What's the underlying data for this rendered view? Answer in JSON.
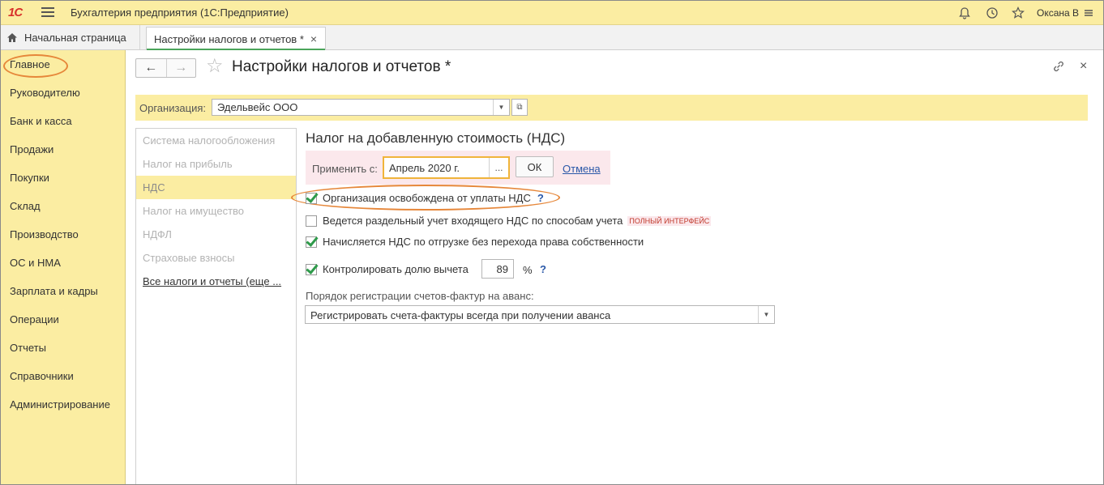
{
  "app": {
    "logo": "1С",
    "title": "Бухгалтерия предприятия",
    "subtitle": "(1С:Предприятие)",
    "user": "Оксана В",
    "accent_color": "#fbeda2",
    "icons": [
      "bell-icon",
      "history-icon",
      "star-icon",
      "chevron-down-icon"
    ]
  },
  "tabs": {
    "home": "Начальная страница",
    "active": "Настройки налогов и отчетов *",
    "close": "×"
  },
  "sidebar": {
    "items": [
      "Главное",
      "Руководителю",
      "Банк и касса",
      "Продажи",
      "Покупки",
      "Склад",
      "Производство",
      "ОС и НМА",
      "Зарплата и кадры",
      "Операции",
      "Отчеты",
      "Справочники",
      "Администрирование"
    ]
  },
  "page": {
    "title": "Настройки налогов и отчетов *"
  },
  "org": {
    "label": "Организация:",
    "value": "Эдельвейс ООО"
  },
  "sections": {
    "items": [
      "Система налогообложения",
      "Налог на прибыль",
      "НДС",
      "Налог на имущество",
      "НДФЛ",
      "Страховые взносы",
      "Все налоги и отчеты (еще ..."
    ],
    "active_index": 2
  },
  "vat": {
    "title": "Налог на добавленную стоимость (НДС)",
    "apply_label": "Применить с:",
    "apply_date": "Апрель 2020 г.",
    "dots": "...",
    "ok": "ОК",
    "cancel": "Отмена",
    "exempt_label": "Организация освобождена от уплаты НДС",
    "exempt_checked": true,
    "separate_label": "Ведется раздельный учет входящего НДС по способам учета",
    "separate_checked": false,
    "full_interface": "полный интерфейс",
    "shipment_label": "Начисляется НДС по отгрузке без перехода права собственности",
    "shipment_checked": true,
    "control_label": "Контролировать долю вычета",
    "control_checked": true,
    "control_value": "89",
    "percent": "%",
    "help": "?",
    "invoice_label": "Порядок регистрации счетов-фактур на аванс:",
    "invoice_value": "Регистрировать счета-фактуры всегда при получении аванса"
  }
}
